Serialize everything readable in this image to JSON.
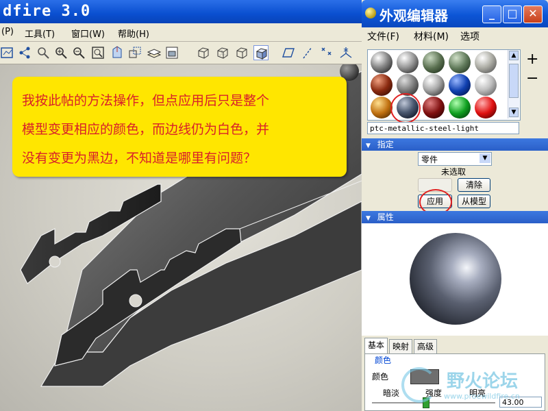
{
  "main_window": {
    "title": "dfire 3.0",
    "menu": [
      "(P)",
      "工具(T)",
      "窗口(W)",
      "帮助(H)"
    ]
  },
  "callout": {
    "lines": [
      "我按此帖的方法操作，但点应用后只是整个",
      "模型变更相应的颜色，而边线仍为白色，并",
      "没有变更为黑边，不知道是哪里有问题？"
    ]
  },
  "editor": {
    "title": "外观编辑器",
    "menu": [
      "文件(F)",
      "材料(M)",
      "选项"
    ],
    "add_label": "+",
    "remove_label": "−",
    "selected_appearance": "ptc-metallic-steel-light",
    "assign_header": "指定",
    "assign_type": "零件",
    "assign_status": "未选取",
    "clear_button": "清除",
    "apply_button": "应用",
    "from_model_button": "从模型",
    "properties_header": "属性",
    "tabs": [
      "基本",
      "映射",
      "高级"
    ],
    "color_group": "颜色",
    "color_label": "颜色",
    "dim_label": "暗淡",
    "intensity_label": "强度",
    "bright_label": "明亮",
    "intensity_value": "43.00"
  },
  "watermark": {
    "brand": "野火论坛",
    "url": "www.proewildfire.cn"
  },
  "colors": {
    "callout_bg": "#ffe600",
    "callout_text": "#d8202a",
    "titlebar": "#0a4fd0",
    "highlight": "#e02020"
  }
}
